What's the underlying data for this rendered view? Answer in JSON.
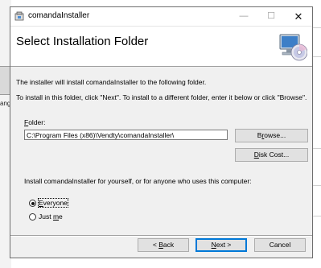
{
  "background": {
    "icon_label": "ang"
  },
  "window": {
    "title": "comandaInstaller",
    "controls": {
      "minimize": "—",
      "maximize": "☐",
      "close": "✕"
    }
  },
  "banner": {
    "title": "Select Installation Folder"
  },
  "body": {
    "intro": "The installer will install comandaInstaller to the following folder.",
    "instructions": "To install in this folder, click \"Next\". To install to a different folder, enter it below or click \"Browse\".",
    "folder_label_underlined": "F",
    "folder_label_rest": "older:",
    "folder_value": "C:\\Program Files (x86)\\Vendty\\comandaInstaller\\",
    "browse_underlined": "r",
    "browse_pre": "B",
    "browse_post": "owse...",
    "disk_cost_underlined": "D",
    "disk_cost_rest": "isk Cost...",
    "install_for": "Install comandaInstaller for yourself, or for anyone who uses this computer:",
    "everyone_underlined": "E",
    "everyone_rest": "veryone",
    "everyone_selected": true,
    "justme_pre": "Just ",
    "justme_underlined": "m",
    "justme_rest": "e"
  },
  "footer": {
    "back_prefix": "< ",
    "back_underlined": "B",
    "back_rest": "ack",
    "next_underlined": "N",
    "next_rest": "ext >",
    "cancel": "Cancel"
  }
}
